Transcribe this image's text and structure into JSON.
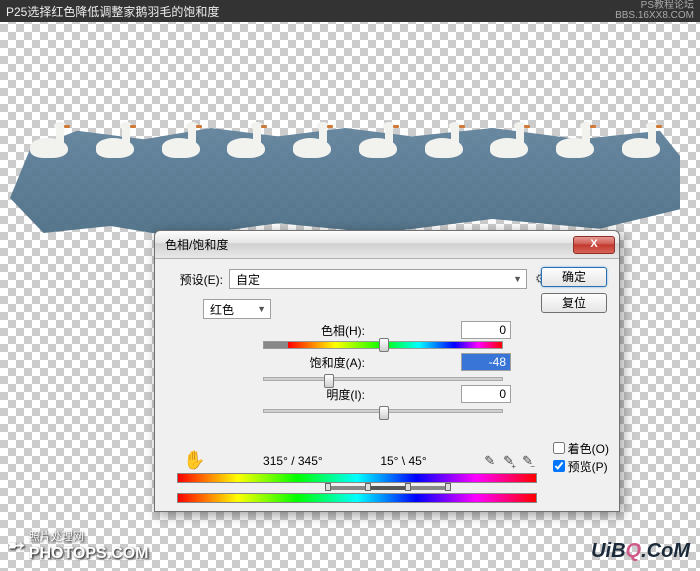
{
  "topbar": {
    "caption": "P25选择红色降低调整家鹅羽毛的饱和度",
    "watermark_line1": "PS教程论坛",
    "watermark_line2": "BBS.16XX8.COM"
  },
  "dialog": {
    "title": "色相/饱和度",
    "close": "X",
    "preset_label": "预设(E):",
    "preset_value": "自定",
    "ok": "确定",
    "cancel": "复位",
    "channel_value": "红色",
    "hue_label": "色相(H):",
    "hue_value": "0",
    "sat_label": "饱和度(A):",
    "sat_value": "-48",
    "light_label": "明度(I):",
    "light_value": "0",
    "angle_left": "315° / 345°",
    "angle_right": "15° \\ 45°",
    "colorize_label": "着色(O)",
    "colorize_checked": false,
    "preview_label": "预览(P)",
    "preview_checked": true
  },
  "watermarks": {
    "bottom_left_cn": "照片处理网",
    "bottom_left_en": "PHOTOPS.COM",
    "bottom_right": "UiBQ.CoM"
  }
}
